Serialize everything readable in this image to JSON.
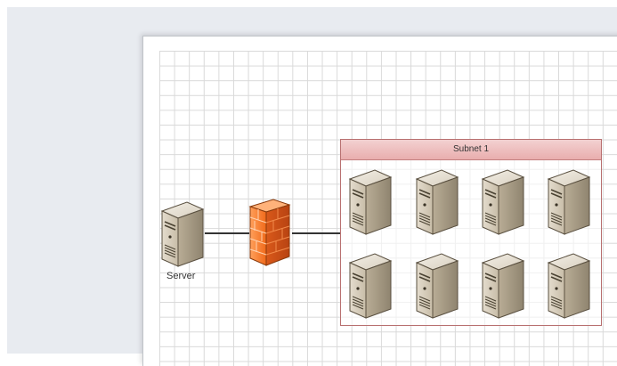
{
  "diagram": {
    "server_label": "Server",
    "subnet_title": "Subnet 1",
    "subnet_server_count": 8
  },
  "colors": {
    "workspace": "#e8ebf0",
    "grid": "#d9d9d9",
    "subnet_border": "#b87070",
    "subnet_header": "#f3d1d1",
    "firewall": "#f07b2a",
    "connector": "#333333"
  },
  "icons": {
    "server": "server-icon",
    "firewall": "firewall-icon"
  }
}
